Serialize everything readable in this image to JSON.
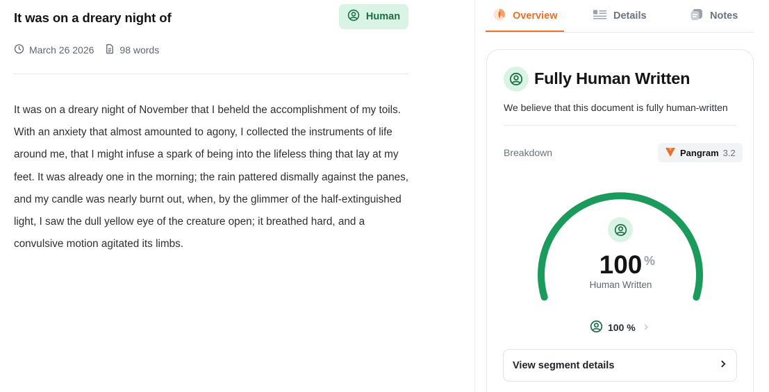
{
  "document": {
    "title": "It was on a dreary night of",
    "badge_label": "Human",
    "date": "March 26 2026",
    "word_count": "98 words",
    "body": "It was on a dreary night of November that I beheld the accomplishment of my toils. With an anxiety that almost amounted to agony, I collected the instruments of life around me, that I might infuse a spark of being into the lifeless thing that lay at my feet. It was already one in the morning; the rain pattered dismally against the panes, and my candle was nearly burnt out, when, by the glimmer of the half-extinguished light, I saw the dull yellow eye of the creature open; it breathed hard, and a convulsive motion agitated its limbs."
  },
  "tabs": [
    {
      "label": "Overview",
      "icon": "overview-icon",
      "active": true
    },
    {
      "label": "Details",
      "icon": "details-icon",
      "active": false
    },
    {
      "label": "Notes",
      "icon": "notes-icon",
      "active": false
    }
  ],
  "result": {
    "title": "Fully Human Written",
    "subtitle": "We believe that this document is fully human-written",
    "breakdown_label": "Breakdown",
    "model_name": "Pangram",
    "model_version": "3.2",
    "gauge_value": "100",
    "gauge_unit": "%",
    "gauge_fraction": 1.0,
    "gauge_caption": "Human Written",
    "human_score": "100 %",
    "segment_button": "View segment details"
  },
  "colors": {
    "accent": "#e8702a",
    "human_green": "#1a9a5b",
    "human_badge_bg": "#d9f3e4",
    "human_badge_text": "#1d6e47"
  }
}
